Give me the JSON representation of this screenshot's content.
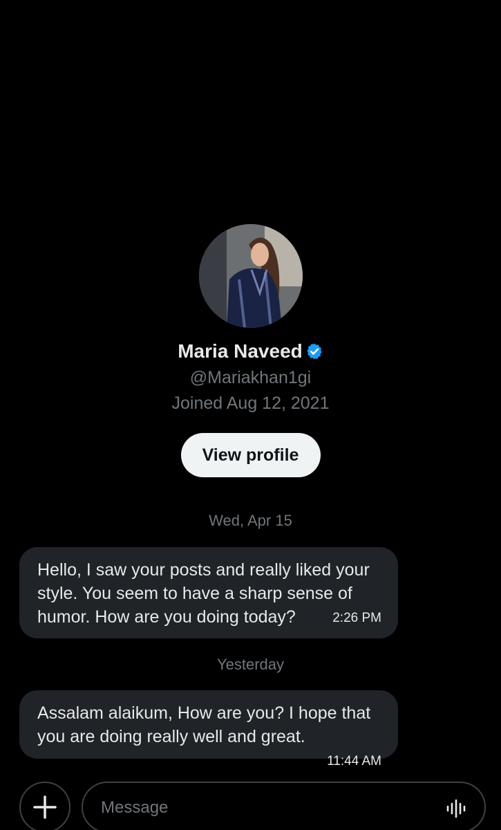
{
  "profile": {
    "name": "Maria Naveed",
    "handle": "@Mariakhan1gi",
    "joined": "Joined Aug 12, 2021",
    "view_profile_label": "View profile",
    "verified_color": "#1d9bf0"
  },
  "messages": [
    {
      "date": "Wed, Apr 15",
      "text": "Hello, I saw your posts and really liked your style. You seem to have a sharp sense of humor. How are you doing today?",
      "time": "2:26 PM"
    },
    {
      "date": "Yesterday",
      "text": "Assalam alaikum, How are you? I hope that you are doing really well and great.",
      "time": "11:44 AM"
    }
  ],
  "composer": {
    "placeholder": "Message",
    "add_icon": "plus-icon",
    "voice_icon": "voice-wave-icon"
  },
  "colors": {
    "background": "#000000",
    "bubble": "#202327",
    "muted_text": "#71767b",
    "button_bg": "#eff3f4"
  }
}
